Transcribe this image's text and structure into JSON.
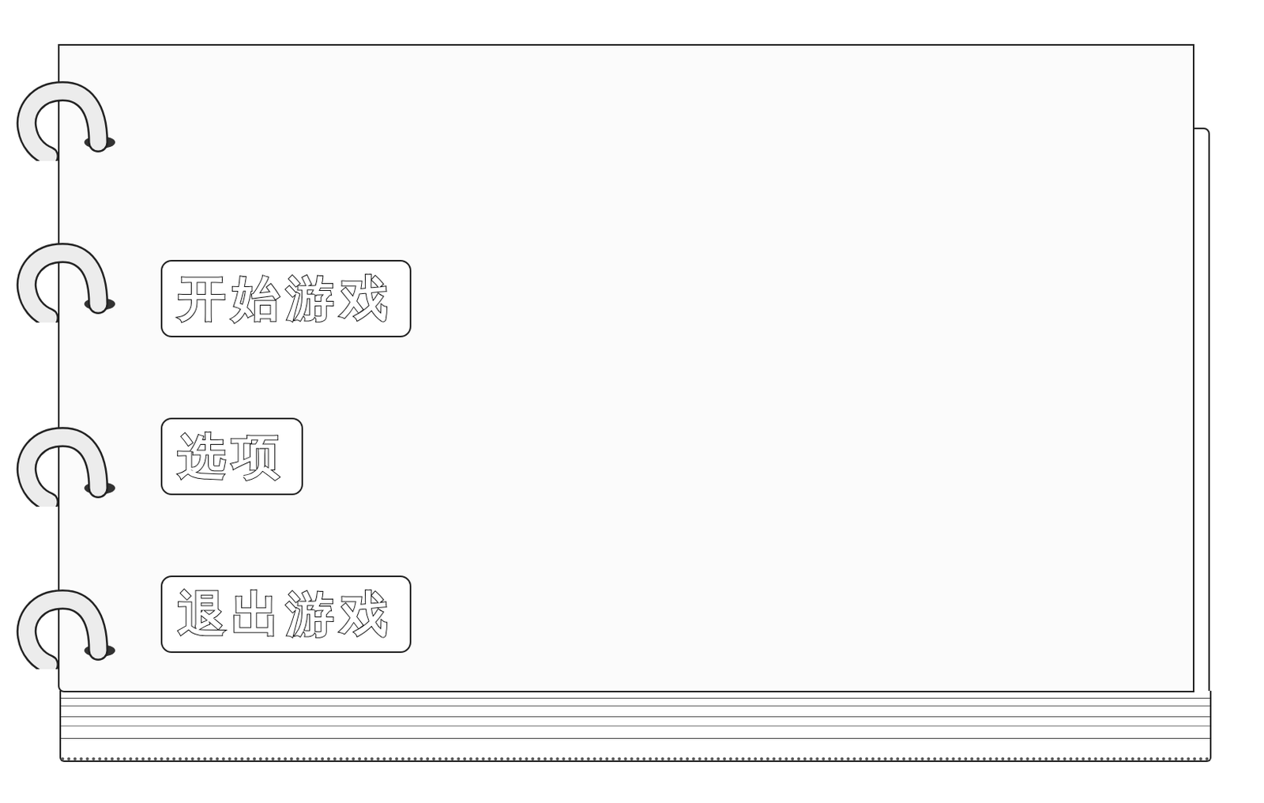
{
  "menu": {
    "buttons": [
      {
        "label": "开始游戏"
      },
      {
        "label": "选项"
      },
      {
        "label": "退出游戏"
      }
    ]
  }
}
